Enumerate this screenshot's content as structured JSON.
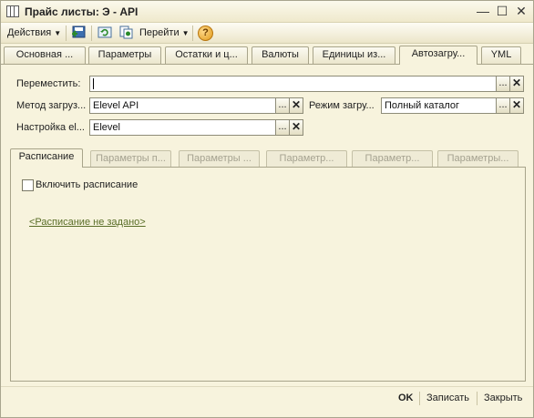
{
  "window": {
    "title": "Прайс листы: Э - API",
    "controls": {
      "minimize": "—",
      "maximize": "☐",
      "close": "✕"
    }
  },
  "toolbar": {
    "actions_label": "Действия",
    "goto_label": "Перейти",
    "icons": [
      "save-icon",
      "refresh-icon",
      "copy-icon",
      "help-icon"
    ],
    "help_glyph": "?"
  },
  "tabs": [
    {
      "label": "Основная ..."
    },
    {
      "label": "Параметры"
    },
    {
      "label": "Остатки и ц..."
    },
    {
      "label": "Валюты"
    },
    {
      "label": "Единицы из..."
    },
    {
      "label": "Автозагру...",
      "active": true
    },
    {
      "label": "YML"
    }
  ],
  "form": {
    "move_label": "Переместить:",
    "move_value": "",
    "method_label": "Метод загруз...",
    "method_value": "Elevel API",
    "mode_label": "Режим загру...",
    "mode_value": "Полный каталог",
    "settings_label": "Настройка el...",
    "settings_value": "Elevel",
    "ellipsis": "...",
    "clear": "✕"
  },
  "inner_tabs": [
    {
      "label": "Расписание",
      "active": true
    },
    {
      "label": "Параметры п..."
    },
    {
      "label": "Параметры ..."
    },
    {
      "label": "Параметр..."
    },
    {
      "label": "Параметр..."
    },
    {
      "label": "Параметры..."
    }
  ],
  "schedule": {
    "enable_label": "Включить расписание",
    "enabled": false,
    "link_text": "<Расписание не задано>"
  },
  "footer": {
    "ok_label": "OK",
    "save_label": "Записать",
    "close_label": "Закрыть"
  },
  "colors": {
    "background": "#f7f3dd",
    "link": "#5a6e28",
    "border": "#a8a48a"
  }
}
